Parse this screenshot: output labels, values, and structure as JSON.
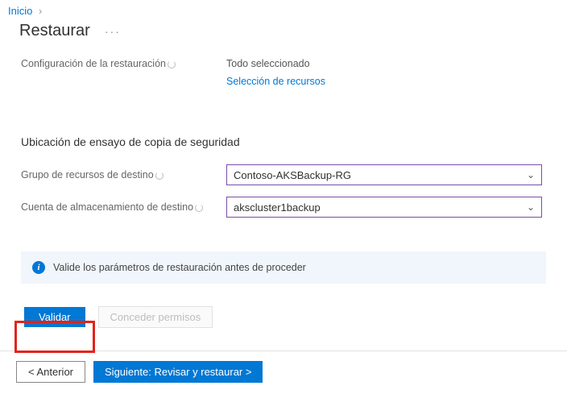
{
  "breadcrumb": {
    "home": "Inicio"
  },
  "page": {
    "title": "Restaurar",
    "ellipsis": "···"
  },
  "config": {
    "label": "Configuración de la restauración",
    "value": "Todo seleccionado",
    "select_link": "Selección de recursos"
  },
  "staging": {
    "heading": "Ubicación de ensayo de copia de seguridad",
    "rg_label": "Grupo de recursos de destino",
    "rg_value": "Contoso-AKSBackup-RG",
    "sa_label": "Cuenta de almacenamiento de destino",
    "sa_value": "akscluster1backup"
  },
  "banner": {
    "text": "Valide los parámetros de restauración antes de proceder"
  },
  "actions": {
    "validate": "Validar",
    "grant": "Conceder permisos"
  },
  "footer": {
    "previous": "<  Anterior",
    "next": "Siguiente: Revisar y restaurar  >"
  }
}
